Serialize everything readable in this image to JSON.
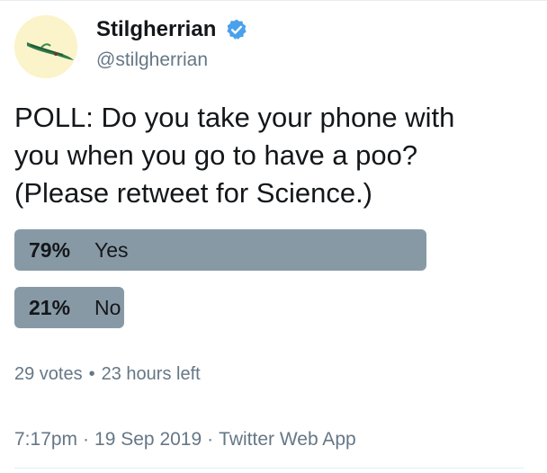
{
  "user": {
    "display_name": "Stilgherrian",
    "handle": "@stilgherrian",
    "avatar_icon": "avatar-creature-icon",
    "verified_icon": "verified-badge-icon",
    "verified_color": "#4aa1eb"
  },
  "tweet": {
    "text_line1": "POLL: Do you take your phone with",
    "text_line2": "you when you go to have a poo?",
    "text_line3": "(Please retweet for Science.)"
  },
  "poll": {
    "choices": [
      {
        "percent": 79,
        "percent_label": "79%",
        "label": "Yes"
      },
      {
        "percent": 21,
        "percent_label": "21%",
        "label": "No"
      }
    ],
    "votes": "29 votes",
    "separator": "•",
    "time_left": "23 hours left",
    "bar_color": "#8899a6"
  },
  "meta": {
    "time": "7:17pm",
    "separator": "·",
    "date": "19 Sep 2019",
    "source": "Twitter Web App"
  }
}
